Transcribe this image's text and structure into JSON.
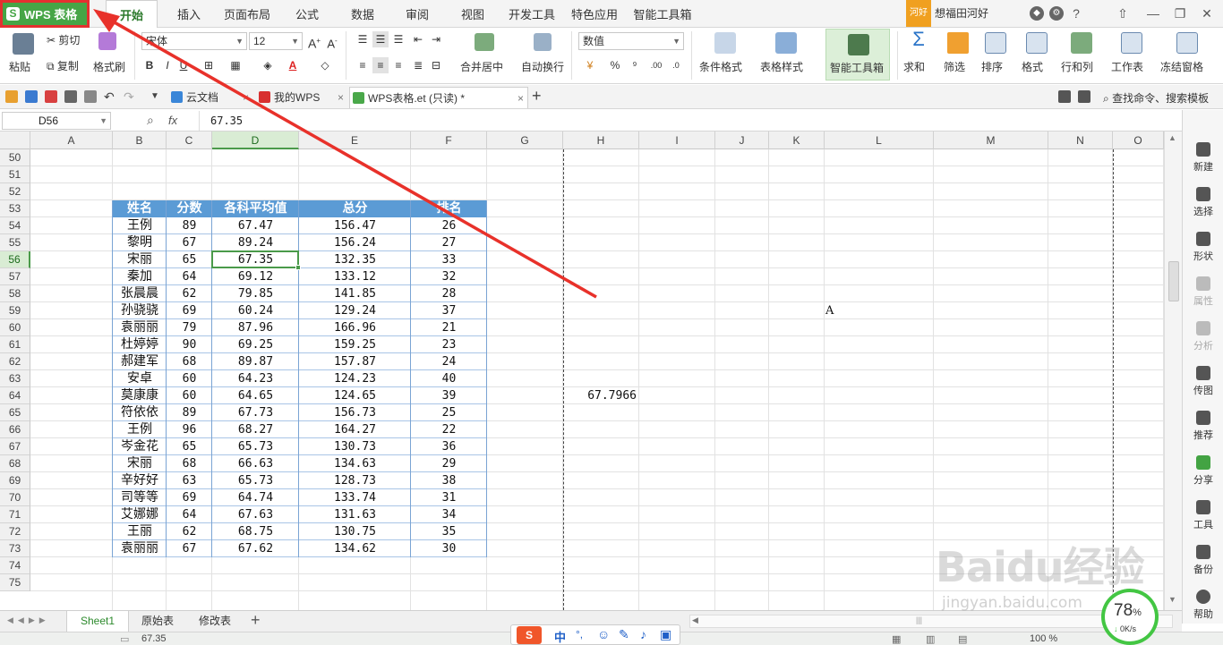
{
  "app": {
    "brand": "WPS 表格",
    "brand_glyph": "S"
  },
  "menu": {
    "tabs": [
      "开始",
      "插入",
      "页面布局",
      "公式",
      "数据",
      "审阅",
      "视图",
      "开发工具",
      "特色应用",
      "智能工具箱"
    ],
    "active": "开始",
    "user_badge": "河好",
    "user_name": "想福田河好"
  },
  "ribbon": {
    "paste": "粘贴",
    "cut": "剪切",
    "copy": "复制",
    "format_painter": "格式刷",
    "font_name": "宋体",
    "font_size": "12",
    "bold": "B",
    "italic": "I",
    "underline": "U",
    "font_color_glyph": "A",
    "merge_center": "合并居中",
    "wrap_text": "自动换行",
    "number_format": "数值",
    "percent": "%",
    "thousands": "⁹",
    "cond_format": "条件格式",
    "table_style": "表格样式",
    "smart_tools": "智能工具箱",
    "sum": "求和",
    "filter": "筛选",
    "sort": "排序",
    "format": "格式",
    "row_col": "行和列",
    "worksheet": "工作表",
    "freeze": "冻结窗格"
  },
  "doc_tabs": [
    {
      "label": "云文档",
      "color": "#3a86d8"
    },
    {
      "label": "我的WPS",
      "color": "#d83030"
    },
    {
      "label": "WPS表格.et (只读) *",
      "color": "#4aa84a"
    }
  ],
  "search": {
    "label": "查找命令、搜索模板"
  },
  "formula_bar": {
    "name_box": "D56",
    "fx": "fx",
    "value": "67.35"
  },
  "columns": [
    "A",
    "B",
    "C",
    "D",
    "E",
    "F",
    "G",
    "H",
    "I",
    "J",
    "K",
    "L",
    "M",
    "N",
    "O"
  ],
  "row_numbers": [
    "50",
    "51",
    "52",
    "53",
    "54",
    "55",
    "56",
    "57",
    "58",
    "59",
    "60",
    "61",
    "62",
    "63",
    "64",
    "65",
    "66",
    "67",
    "68",
    "69",
    "70",
    "71",
    "72",
    "73",
    "74",
    "75"
  ],
  "table": {
    "headers": [
      "姓名",
      "分数",
      "各科平均值",
      "总分",
      "排名"
    ],
    "rows": [
      [
        "王例",
        "89",
        "67.47",
        "156.47",
        "26"
      ],
      [
        "黎明",
        "67",
        "89.24",
        "156.24",
        "27"
      ],
      [
        "宋丽",
        "65",
        "67.35",
        "132.35",
        "33"
      ],
      [
        "秦加",
        "64",
        "69.12",
        "133.12",
        "32"
      ],
      [
        "张晨晨",
        "62",
        "79.85",
        "141.85",
        "28"
      ],
      [
        "孙骁骁",
        "69",
        "60.24",
        "129.24",
        "37"
      ],
      [
        "袁丽丽",
        "79",
        "87.96",
        "166.96",
        "21"
      ],
      [
        "杜婷婷",
        "90",
        "69.25",
        "159.25",
        "23"
      ],
      [
        "郝建军",
        "68",
        "89.87",
        "157.87",
        "24"
      ],
      [
        "安卓",
        "60",
        "64.23",
        "124.23",
        "40"
      ],
      [
        "莫康康",
        "60",
        "64.65",
        "124.65",
        "39"
      ],
      [
        "符依依",
        "89",
        "67.73",
        "156.73",
        "25"
      ],
      [
        "王例",
        "96",
        "68.27",
        "164.27",
        "22"
      ],
      [
        "岑金花",
        "65",
        "65.73",
        "130.73",
        "36"
      ],
      [
        "宋丽",
        "68",
        "66.63",
        "134.63",
        "29"
      ],
      [
        "辛好好",
        "63",
        "65.73",
        "128.73",
        "38"
      ],
      [
        "司等等",
        "69",
        "64.74",
        "133.74",
        "31"
      ],
      [
        "艾娜娜",
        "64",
        "67.63",
        "131.63",
        "34"
      ],
      [
        "王丽",
        "62",
        "68.75",
        "130.75",
        "35"
      ],
      [
        "袁丽丽",
        "67",
        "67.62",
        "134.62",
        "30"
      ]
    ]
  },
  "extra_cells": {
    "h64": "67.7966",
    "l59": "A"
  },
  "sidebar": [
    "新建",
    "选择",
    "形状",
    "属性",
    "分析",
    "传图",
    "推荐",
    "分享",
    "工具",
    "备份",
    "帮助"
  ],
  "sheets": [
    "Sheet1",
    "原始表",
    "修改表"
  ],
  "active_sheet": "Sheet1",
  "status": {
    "value": "67.35",
    "zoom": "100 %"
  },
  "net_widget": {
    "percent": "78",
    "unit": "%",
    "speed": "0K/s"
  },
  "watermark": {
    "main": "Baidu经验",
    "sub": "jingyan.baidu.com"
  }
}
